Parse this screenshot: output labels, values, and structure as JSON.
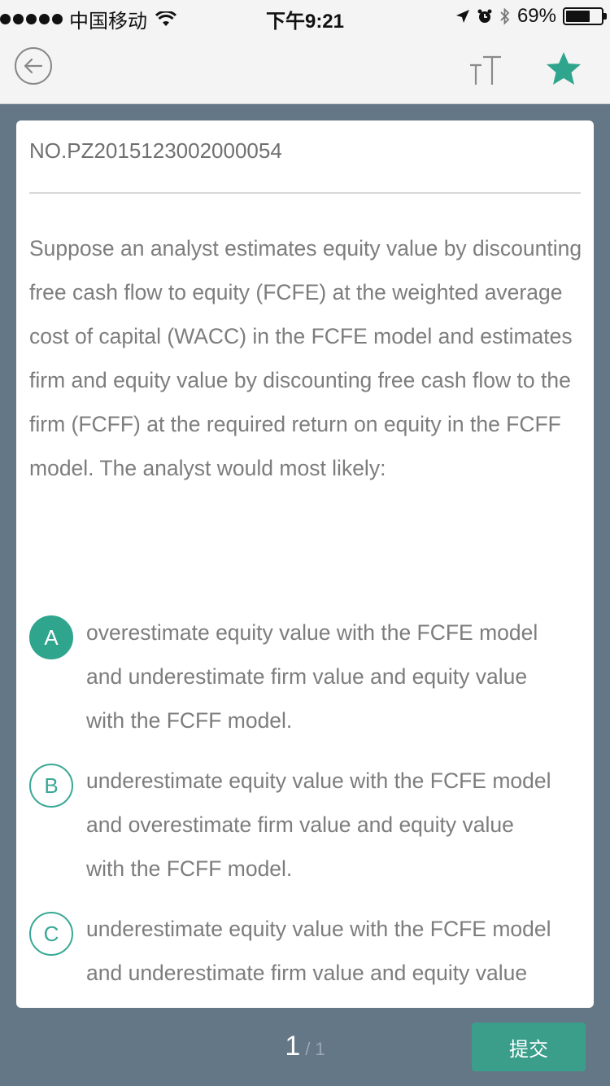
{
  "status_bar": {
    "carrier": "中国移动",
    "time": "下午9:21",
    "battery_percent": "69%",
    "battery_level": 0.69
  },
  "nav": {
    "back_icon": "back-arrow-icon",
    "font_icon": "font-size-icon",
    "star_icon": "star-icon",
    "accent_color": "#2fa58e"
  },
  "question": {
    "number": "NO.PZ2015123002000054",
    "text": "Suppose an analyst estimates equity value by discounting free cash flow to equity (FCFE) at the weighted average cost of capital (WACC) in the FCFE model and estimates firm and equity value by discounting free cash flow to the firm (FCFF) at the required return on equity in the FCFF model. The analyst would most likely:"
  },
  "options": [
    {
      "letter": "A",
      "selected": true,
      "lines": [
        "overestimate equity value with the FCFE model",
        "and underestimate firm value and equity value",
        "with the FCFF model."
      ]
    },
    {
      "letter": "B",
      "selected": false,
      "lines": [
        "underestimate equity value with the FCFE model",
        "and overestimate firm value and equity value",
        "with the FCFF model."
      ]
    },
    {
      "letter": "C",
      "selected": false,
      "lines": [
        "underestimate equity value with the FCFE model",
        "and underestimate firm value and equity value"
      ]
    }
  ],
  "footer": {
    "page_current": "1",
    "page_separator": "/",
    "page_total": "1",
    "submit_label": "提交"
  }
}
